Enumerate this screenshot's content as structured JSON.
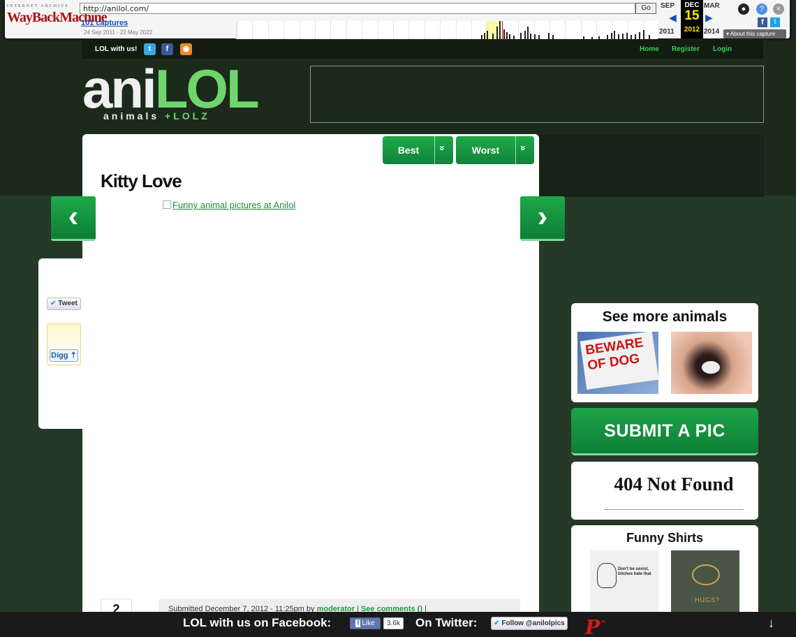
{
  "wayback": {
    "logo_top": "INTERNET ARCHIVE",
    "logo_main": "WayBackMachine",
    "url": "http://anilol.com/",
    "go_label": "Go",
    "captures": "101 captures",
    "range": "24 Sep 2011 - 22 May 2022",
    "prev_month": "SEP",
    "cur_month": "DEC",
    "next_month": "MAR",
    "cur_day": "15",
    "prev_year": "2011",
    "cur_year": "2012",
    "next_year": "2014",
    "about": "About this capture",
    "prev_arrow": "◀",
    "next_arrow": "▶",
    "icons": [
      "user-icon",
      "help-icon",
      "close-icon",
      "facebook-icon",
      "twitter-icon"
    ]
  },
  "topbar": {
    "lol_with_us": "LOL with us!",
    "social": [
      {
        "icon": "twitter-icon",
        "glyph": "t",
        "color": "#38a7e0"
      },
      {
        "icon": "facebook-icon",
        "glyph": "f",
        "color": "#3b5998"
      },
      {
        "icon": "rss-icon",
        "glyph": "◉",
        "color": "#f08a24"
      }
    ],
    "nav": {
      "home": "Home",
      "register": "Register",
      "login": "Login"
    }
  },
  "logo": {
    "ani": "ani",
    "lol": "LOL",
    "sub_left": "animals ",
    "sub_plus": "+",
    "sub_right": "LOLZ"
  },
  "sort": {
    "best": "Best",
    "worst": "Worst",
    "chevron": "»"
  },
  "post": {
    "title": "Kitty Love",
    "image_alt": "Funny animal pictures at Anilol",
    "prev_glyph": "‹",
    "next_glyph": "›",
    "score": "2",
    "submitted_prefix": "Submitted December 7, 2012 - 11:25pm by ",
    "author": "moderator",
    "separator": " | ",
    "comments": "See comments ()",
    "trailing": " |"
  },
  "share": {
    "tweet": "Tweet",
    "tweet_icon": "✔",
    "digg": "Digg",
    "digg_arrow": "⇡"
  },
  "sidebar": {
    "more_animals": "See more animals",
    "dog_sign": "BEWARE OF DOG",
    "submit": "SUBMIT A PIC",
    "not_found": "404 Not Found",
    "shirts": "Funny Shirts",
    "shirt1_text": "Don't be sexist, bitches hate that",
    "shirt2_text": "HUGS?"
  },
  "bottom": {
    "fb_cta": "LOL with us on Facebook:",
    "like": "Like",
    "like_icon": "f",
    "like_count": "3.6k",
    "tw_cta": "On Twitter:",
    "follow": "Follow @anilolpics",
    "follow_icon": "✔",
    "p_logo": "P",
    "p_sup": "^",
    "down_arrow": "↓"
  },
  "colors": {
    "accent": "#1e9a3c",
    "dark_bg": "#1c2a1c",
    "brand_light": "#6fd66d"
  }
}
